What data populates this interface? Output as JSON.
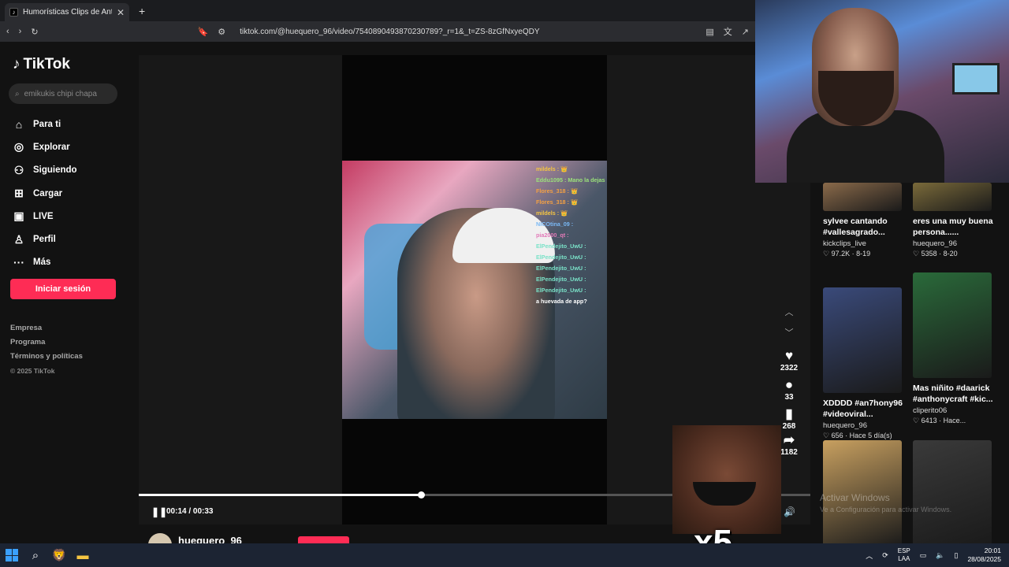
{
  "browser": {
    "tab_title": "Humorísticas Clips de Anthon",
    "tab_close": "✕",
    "new_tab": "+",
    "url": "tiktok.com/@huequero_96/video/7540890493870230789?_r=1&_t=ZS-8zGfNxyeQDY"
  },
  "nav": {
    "logo": "TikTok",
    "search_placeholder": "emikukis chipi chapa",
    "items": [
      {
        "label": "Para ti",
        "icon": "⌂"
      },
      {
        "label": "Explorar",
        "icon": "◎"
      },
      {
        "label": "Siguiendo",
        "icon": "⚇"
      },
      {
        "label": "Cargar",
        "icon": "⊞"
      },
      {
        "label": "LIVE",
        "icon": "▣"
      },
      {
        "label": "Perfil",
        "icon": "♙"
      },
      {
        "label": "Más",
        "icon": "···"
      }
    ],
    "login": "Iniciar sesión",
    "footer": [
      "Empresa",
      "Programa",
      "Términos y políticas"
    ],
    "copyright": "© 2025 TikTok"
  },
  "chat": [
    {
      "text": "mildels : 👑",
      "color": "#f5c542"
    },
    {
      "text": "Eddu1095 : Mano la dejas",
      "color": "#9be27a"
    },
    {
      "text": "Flores_318 : 👑",
      "color": "#f5a142"
    },
    {
      "text": "Flores_318 : 👑",
      "color": "#f5a142"
    },
    {
      "text": "mildels : 👑",
      "color": "#f5c542"
    },
    {
      "text": "NICOtina_09 :",
      "color": "#7ab8f5"
    },
    {
      "text": "pia2000_qt :",
      "color": "#e27ab8"
    },
    {
      "text": "ElPendejito_UwU :",
      "color": "#7ae2c8"
    },
    {
      "text": "ElPendejito_UwU :",
      "color": "#7ae2c8"
    },
    {
      "text": "ElPendejito_UwU :",
      "color": "#7ae2c8"
    },
    {
      "text": "ElPendejito_UwU :",
      "color": "#7ae2c8"
    },
    {
      "text": "ElPendejito_UwU :",
      "color": "#7ae2c8"
    },
    {
      "text": "a huevada de app?",
      "color": "#ffffff"
    }
  ],
  "player": {
    "time": "00:14 / 00:33",
    "progress": 0.42,
    "username": "huequero_96",
    "overlay_text": "x5"
  },
  "actions": {
    "likes": "2322",
    "comments": "33",
    "saves": "268",
    "shares": "1182"
  },
  "grid": [
    {
      "title": "sylvee cantando #vallesagrado...",
      "author": "kickclips_live",
      "meta": "♡ 97.2K · 8-19",
      "color": "#8a6a4a",
      "short": true
    },
    {
      "title": "eres una muy buena persona......",
      "author": "huequero_96",
      "meta": "♡ 5358 · 8-20",
      "color": "#7a6a3a",
      "short": true
    },
    {
      "title": "XDDDD #an7hony96 #videoviral...",
      "author": "huequero_96",
      "meta": "♡ 656 · Hace 5 día(s)",
      "color": "#3a4a7a",
      "short": false
    },
    {
      "title": "Mas niñito #daarick #anthonycraft #kic...",
      "author": "cliperito06",
      "meta": "♡ 6413 · Hace...",
      "color": "#2a6a3a",
      "short": false
    },
    {
      "title": "",
      "author": "",
      "meta": "",
      "color": "#c8a060",
      "short": false
    },
    {
      "title": "",
      "author": "",
      "meta": "",
      "color": "#3a3a3a",
      "short": false
    }
  ],
  "watermark": {
    "line1": "Activar Windows",
    "line2": "Ve a Configuración para activar Windows."
  },
  "taskbar": {
    "lang1": "ESP",
    "lang2": "LAA",
    "time": "20:01",
    "date": "28/08/2025"
  }
}
